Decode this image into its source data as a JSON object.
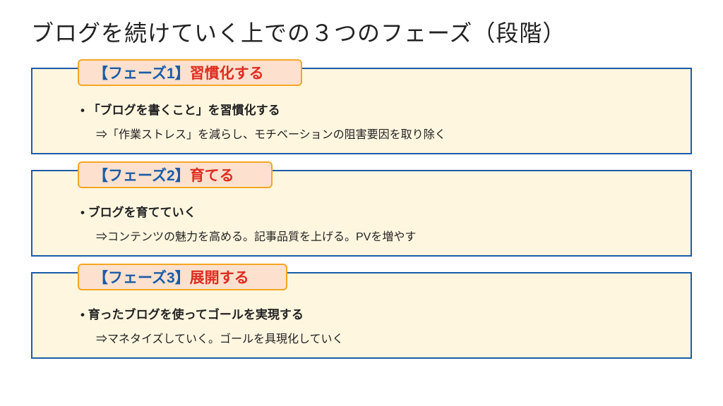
{
  "title": "ブログを続けていく上での３つのフェーズ（段階）",
  "phases": [
    {
      "label_prefix": "【フェーズ1】",
      "label_red": "習慣化する",
      "bullet_bold": "「ブログを書くこと」を習慣化する",
      "bullet_detail": "⇒「作業ストレス」を減らし、モチベーションの阻害要因を取り除く"
    },
    {
      "label_prefix": "【フェーズ2】",
      "label_red": "育てる",
      "bullet_bold": "ブログを育てていく",
      "bullet_detail": "⇒コンテンツの魅力を高める。記事品質を上げる。PVを増やす"
    },
    {
      "label_prefix": "【フェーズ3】",
      "label_red": "展開する",
      "bullet_bold": "育ったブログを使ってゴールを実現する",
      "bullet_detail": "⇒マネタイズしていく。ゴールを具現化していく"
    }
  ]
}
